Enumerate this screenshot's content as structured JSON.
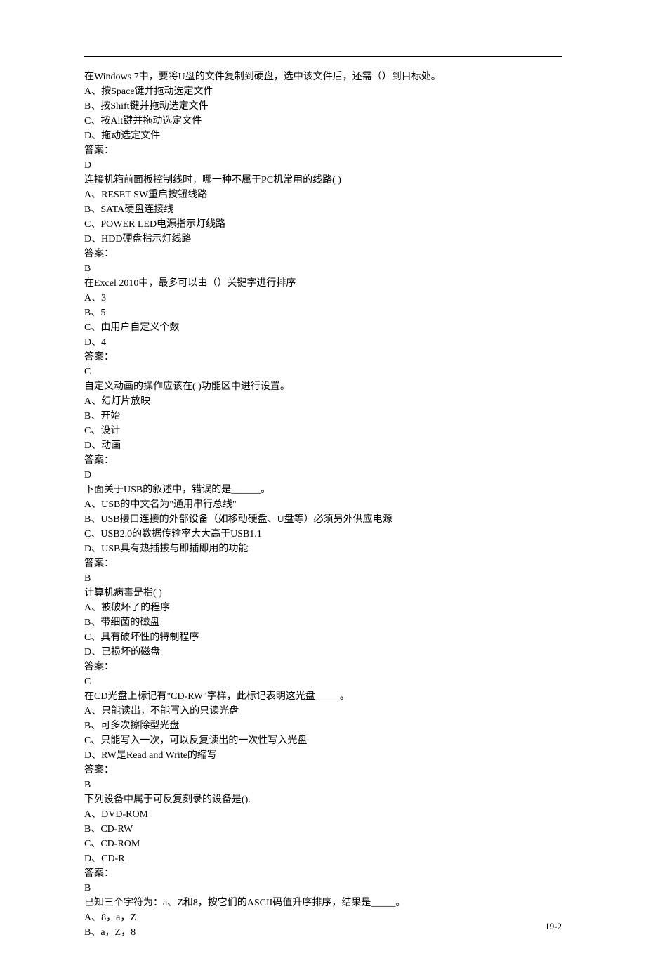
{
  "questions": [
    {
      "stem": "在Windows 7中，要将U盘的文件复制到硬盘，选中该文件后，还需（）到目标处。",
      "options": [
        "A、按Space键并拖动选定文件",
        "B、按Shift键并拖动选定文件",
        "C、按Alt键并拖动选定文件",
        "D、拖动选定文件"
      ],
      "answer_label": "答案：",
      "answer": "D"
    },
    {
      "stem": "连接机箱前面板控制线时，哪一种不属于PC机常用的线路(  )",
      "options": [
        "A、RESET SW重启按钮线路",
        "B、SATA硬盘连接线",
        "C、POWER LED电源指示灯线路",
        "D、HDD硬盘指示灯线路"
      ],
      "answer_label": "答案：",
      "answer": "B"
    },
    {
      "stem": "在Excel 2010中，最多可以由（）关键字进行排序",
      "options": [
        "A、3",
        "B、5",
        "C、由用户自定义个数",
        "D、4"
      ],
      "answer_label": "答案：",
      "answer": "C"
    },
    {
      "stem": "自定义动画的操作应该在(  )功能区中进行设置。",
      "options": [
        "A、幻灯片放映",
        "B、开始",
        "C、设计",
        "D、动画"
      ],
      "answer_label": "答案：",
      "answer": "D"
    },
    {
      "stem": "下面关于USB的叙述中，错误的是______。",
      "options": [
        "A、USB的中文名为\"通用串行总线\"",
        "B、USB接口连接的外部设备（如移动硬盘、U盘等）必须另外供应电源",
        "C、USB2.0的数据传输率大大高于USB1.1",
        "D、USB具有热插拔与即插即用的功能"
      ],
      "answer_label": "答案：",
      "answer": "B"
    },
    {
      "stem": "计算机病毒是指(  )",
      "options": [
        "A、被破坏了的程序",
        "B、带细菌的磁盘",
        "C、具有破坏性的特制程序",
        "D、已损坏的磁盘"
      ],
      "answer_label": "答案：",
      "answer": "C"
    },
    {
      "stem": "在CD光盘上标记有\"CD-RW\"字样，此标记表明这光盘_____。",
      "options": [
        "A、只能读出，不能写入的只读光盘",
        "B、可多次擦除型光盘",
        "C、只能写入一次，可以反复读出的一次性写入光盘",
        "D、RW是Read and Write的缩写"
      ],
      "answer_label": "答案：",
      "answer": "B"
    },
    {
      "stem": "下列设备中属于可反复刻录的设备是().",
      "options": [
        "A、DVD-ROM",
        "B、CD-RW",
        "C、CD-ROM",
        "D、CD-R"
      ],
      "answer_label": "答案：",
      "answer": "B"
    },
    {
      "stem": "已知三个字符为：a、Z和8，按它们的ASCII码值升序排序，结果是_____。",
      "options": [
        "A、8，a，Z",
        "B、a，Z，8"
      ],
      "answer_label": "",
      "answer": ""
    }
  ],
  "page_number": "19-2"
}
